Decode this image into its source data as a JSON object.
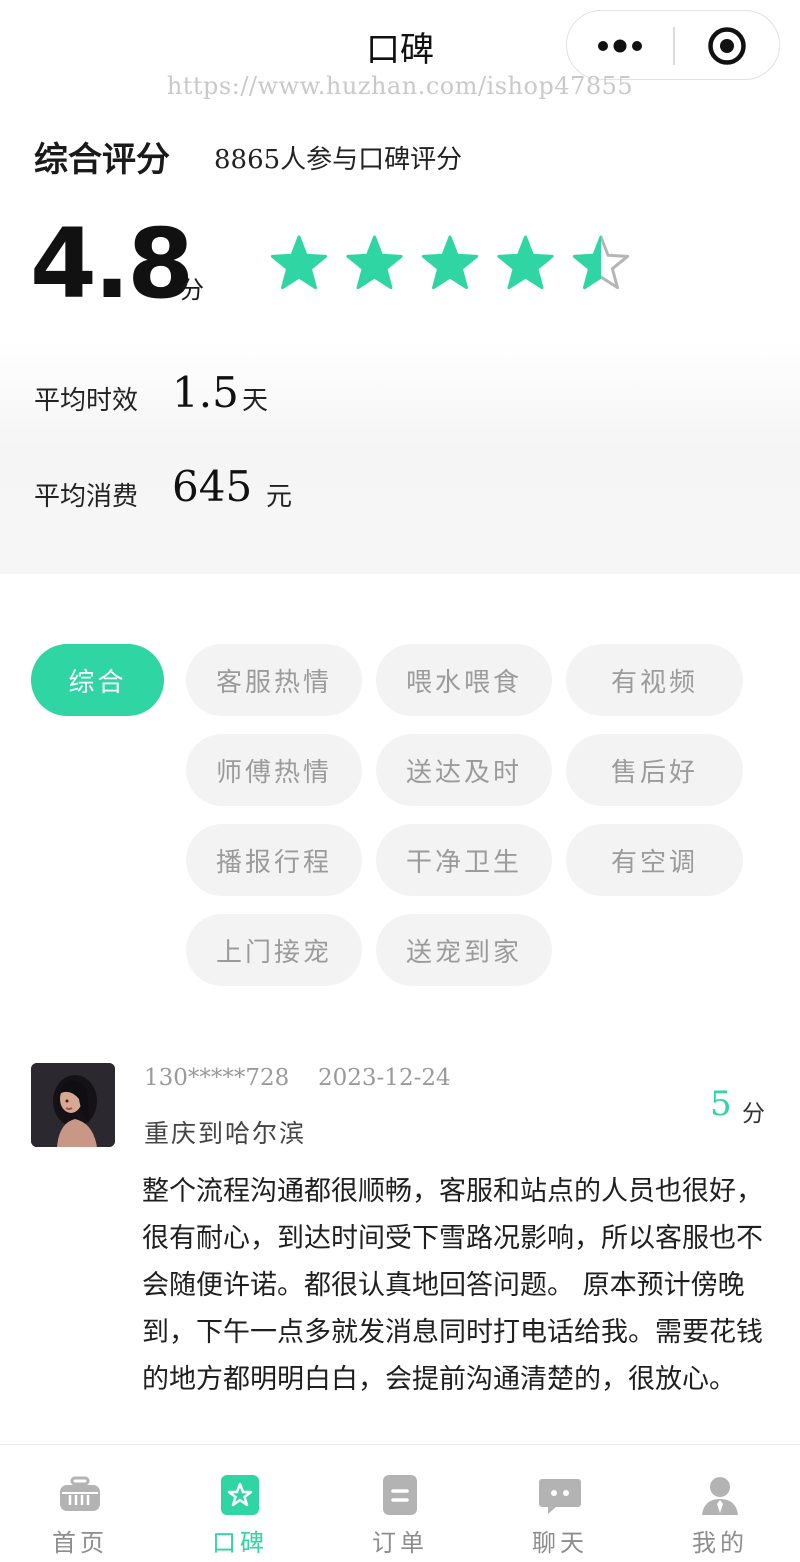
{
  "header": {
    "title": "口碑",
    "watermark": "https://www.huzhan.com/ishop47855"
  },
  "summary": {
    "title": "综合评分",
    "participants": "8865人参与口碑评分",
    "score": "4.8",
    "score_unit": "分",
    "rating_out_of_5": 4.5
  },
  "stats": {
    "time_label": "平均时效",
    "time_value": "1.5",
    "time_unit": "天",
    "cost_label": "平均消费",
    "cost_value": "645",
    "cost_unit": "元"
  },
  "tags": [
    {
      "label": "综合",
      "active": true
    },
    {
      "label": "客服热情",
      "active": false
    },
    {
      "label": "喂水喂食",
      "active": false
    },
    {
      "label": "有视频",
      "active": false
    },
    {
      "label": "师傅热情",
      "active": false
    },
    {
      "label": "送达及时",
      "active": false
    },
    {
      "label": "售后好",
      "active": false
    },
    {
      "label": "播报行程",
      "active": false
    },
    {
      "label": "干净卫生",
      "active": false
    },
    {
      "label": "有空调",
      "active": false
    },
    {
      "label": "上门接宠",
      "active": false
    },
    {
      "label": "送宠到家",
      "active": false
    }
  ],
  "review": {
    "user": "130*****728",
    "date": "2023-12-24",
    "route": "重庆到哈尔滨",
    "score": "5",
    "score_unit": "分",
    "text": "整个流程沟通都很顺畅，客服和站点的人员也很好，很有耐心，到达时间受下雪路况影响，所以客服也不会随便许诺。都很认真地回答问题。 原本预计傍晚到，下午一点多就发消息同时打电话给我。需要花钱的地方都明明白白，会提前沟通清楚的，很放心。"
  },
  "tabbar": [
    {
      "label": "首页",
      "icon": "carrier-icon",
      "active": false
    },
    {
      "label": "口碑",
      "icon": "star-badge-icon",
      "active": true
    },
    {
      "label": "订单",
      "icon": "order-icon",
      "active": false
    },
    {
      "label": "聊天",
      "icon": "chat-icon",
      "active": false
    },
    {
      "label": "我的",
      "icon": "user-icon",
      "active": false
    }
  ],
  "colors": {
    "accent": "#2fd5a2",
    "star_empty": "#b5b5b5",
    "tag_bg": "#f3f3f3",
    "tag_text": "#9b9b9b"
  }
}
